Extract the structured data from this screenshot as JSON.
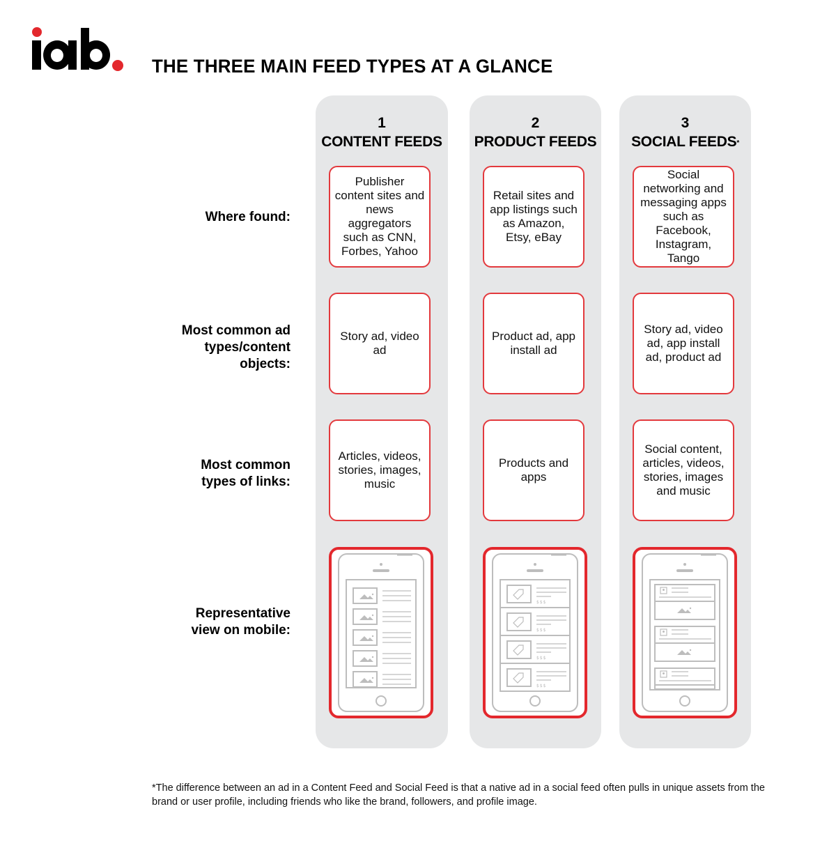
{
  "logo": {
    "text": "iab",
    "brand_color": "#e3282d"
  },
  "header": {
    "title": "THE THREE MAIN FEED TYPES AT A GLANCE"
  },
  "row_labels": [
    {
      "id": "where-found",
      "lines": [
        "Where found:"
      ]
    },
    {
      "id": "ad-types",
      "lines": [
        "Most common ad",
        "types/content",
        "objects:"
      ]
    },
    {
      "id": "link-types",
      "lines": [
        "Most common",
        "types of links:"
      ]
    },
    {
      "id": "mobile-view",
      "lines": [
        "Representative",
        "view on mobile:"
      ]
    }
  ],
  "columns": [
    {
      "number": "1",
      "name": "CONTENT FEEDS",
      "marker": "",
      "where_found": "Publisher content sites and news aggregators such as CNN, Forbes, Yahoo",
      "ad_types": "Story ad, video ad",
      "link_types": "Articles, videos, stories, images, music",
      "mobile_view": "content-feed-phone-icon"
    },
    {
      "number": "2",
      "name": "PRODUCT FEEDS",
      "marker": "",
      "where_found": "Retail sites and app listings such as Amazon, Etsy, eBay",
      "ad_types": "Product ad, app install ad",
      "link_types": "Products and apps",
      "mobile_view": "product-feed-phone-icon",
      "price_placeholder": "$$$"
    },
    {
      "number": "3",
      "name": "SOCIAL FEEDS",
      "marker": "*",
      "where_found": "Social networking and messaging apps such as Facebook, Instagram, Tango",
      "ad_types": "Story ad, video ad, app install ad, product ad",
      "link_types": "Social content, articles, videos, stories, images and music",
      "mobile_view": "social-feed-phone-icon"
    }
  ],
  "footnote": "*The difference between an ad in a Content Feed and Social Feed is that a native ad in a social feed often pulls in unique assets from the brand or user profile, including friends who like the brand, followers, and profile image.",
  "colors": {
    "accent_red": "#e3282d",
    "column_bg": "#e6e7e8",
    "wireframe_gray": "#bdbdbd"
  }
}
